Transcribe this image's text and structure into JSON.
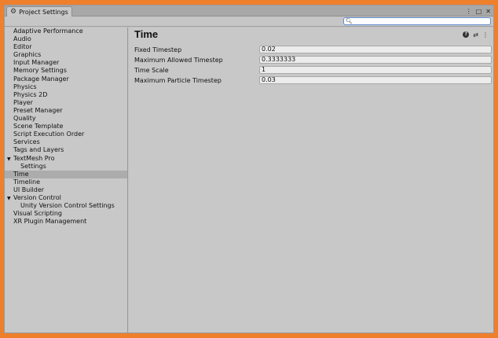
{
  "window": {
    "tab_title": "Project Settings",
    "controls": {
      "menu": "⋮",
      "maximize": "□",
      "close": "✕"
    }
  },
  "search": {
    "placeholder": "",
    "value": ""
  },
  "sidebar": {
    "items": [
      {
        "label": "Adaptive Performance"
      },
      {
        "label": "Audio"
      },
      {
        "label": "Editor"
      },
      {
        "label": "Graphics"
      },
      {
        "label": "Input Manager"
      },
      {
        "label": "Memory Settings"
      },
      {
        "label": "Package Manager"
      },
      {
        "label": "Physics"
      },
      {
        "label": "Physics 2D"
      },
      {
        "label": "Player"
      },
      {
        "label": "Preset Manager"
      },
      {
        "label": "Quality"
      },
      {
        "label": "Scene Template"
      },
      {
        "label": "Script Execution Order"
      },
      {
        "label": "Services"
      },
      {
        "label": "Tags and Layers"
      },
      {
        "label": "TextMesh Pro",
        "expanded": true
      },
      {
        "label": "Settings",
        "child": true
      },
      {
        "label": "Time",
        "selected": true
      },
      {
        "label": "Timeline"
      },
      {
        "label": "UI Builder"
      },
      {
        "label": "Version Control",
        "expanded": true
      },
      {
        "label": "Unity Version Control Settings",
        "child": true
      },
      {
        "label": "Visual Scripting"
      },
      {
        "label": "XR Plugin Management"
      }
    ]
  },
  "main": {
    "title": "Time",
    "icons": {
      "help": "?",
      "presets": "⇄",
      "menu": "⋮"
    },
    "fields": [
      {
        "label": "Fixed Timestep",
        "value": "0.02"
      },
      {
        "label": "Maximum Allowed Timestep",
        "value": "0.3333333"
      },
      {
        "label": "Time Scale",
        "value": "1"
      },
      {
        "label": "Maximum Particle Timestep",
        "value": "0.03"
      }
    ]
  }
}
